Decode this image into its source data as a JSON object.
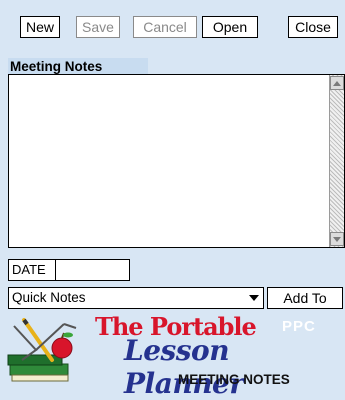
{
  "toolbar": {
    "new_label": "New",
    "save_label": "Save",
    "cancel_label": "Cancel",
    "open_label": "Open",
    "close_label": "Close"
  },
  "notes": {
    "section_label": "Meeting Notes",
    "text": ""
  },
  "date": {
    "label": "DATE",
    "value": ""
  },
  "quick_notes": {
    "selected": "Quick Notes",
    "add_label": "Add To"
  },
  "logo": {
    "line1": "The Portable",
    "badge": "PPC",
    "line2": "Lesson Planner",
    "subtitle": "MEETING NOTES"
  },
  "colors": {
    "background": "#d8e6f4",
    "logo_red": "#d8152b",
    "logo_blue": "#25328f"
  }
}
